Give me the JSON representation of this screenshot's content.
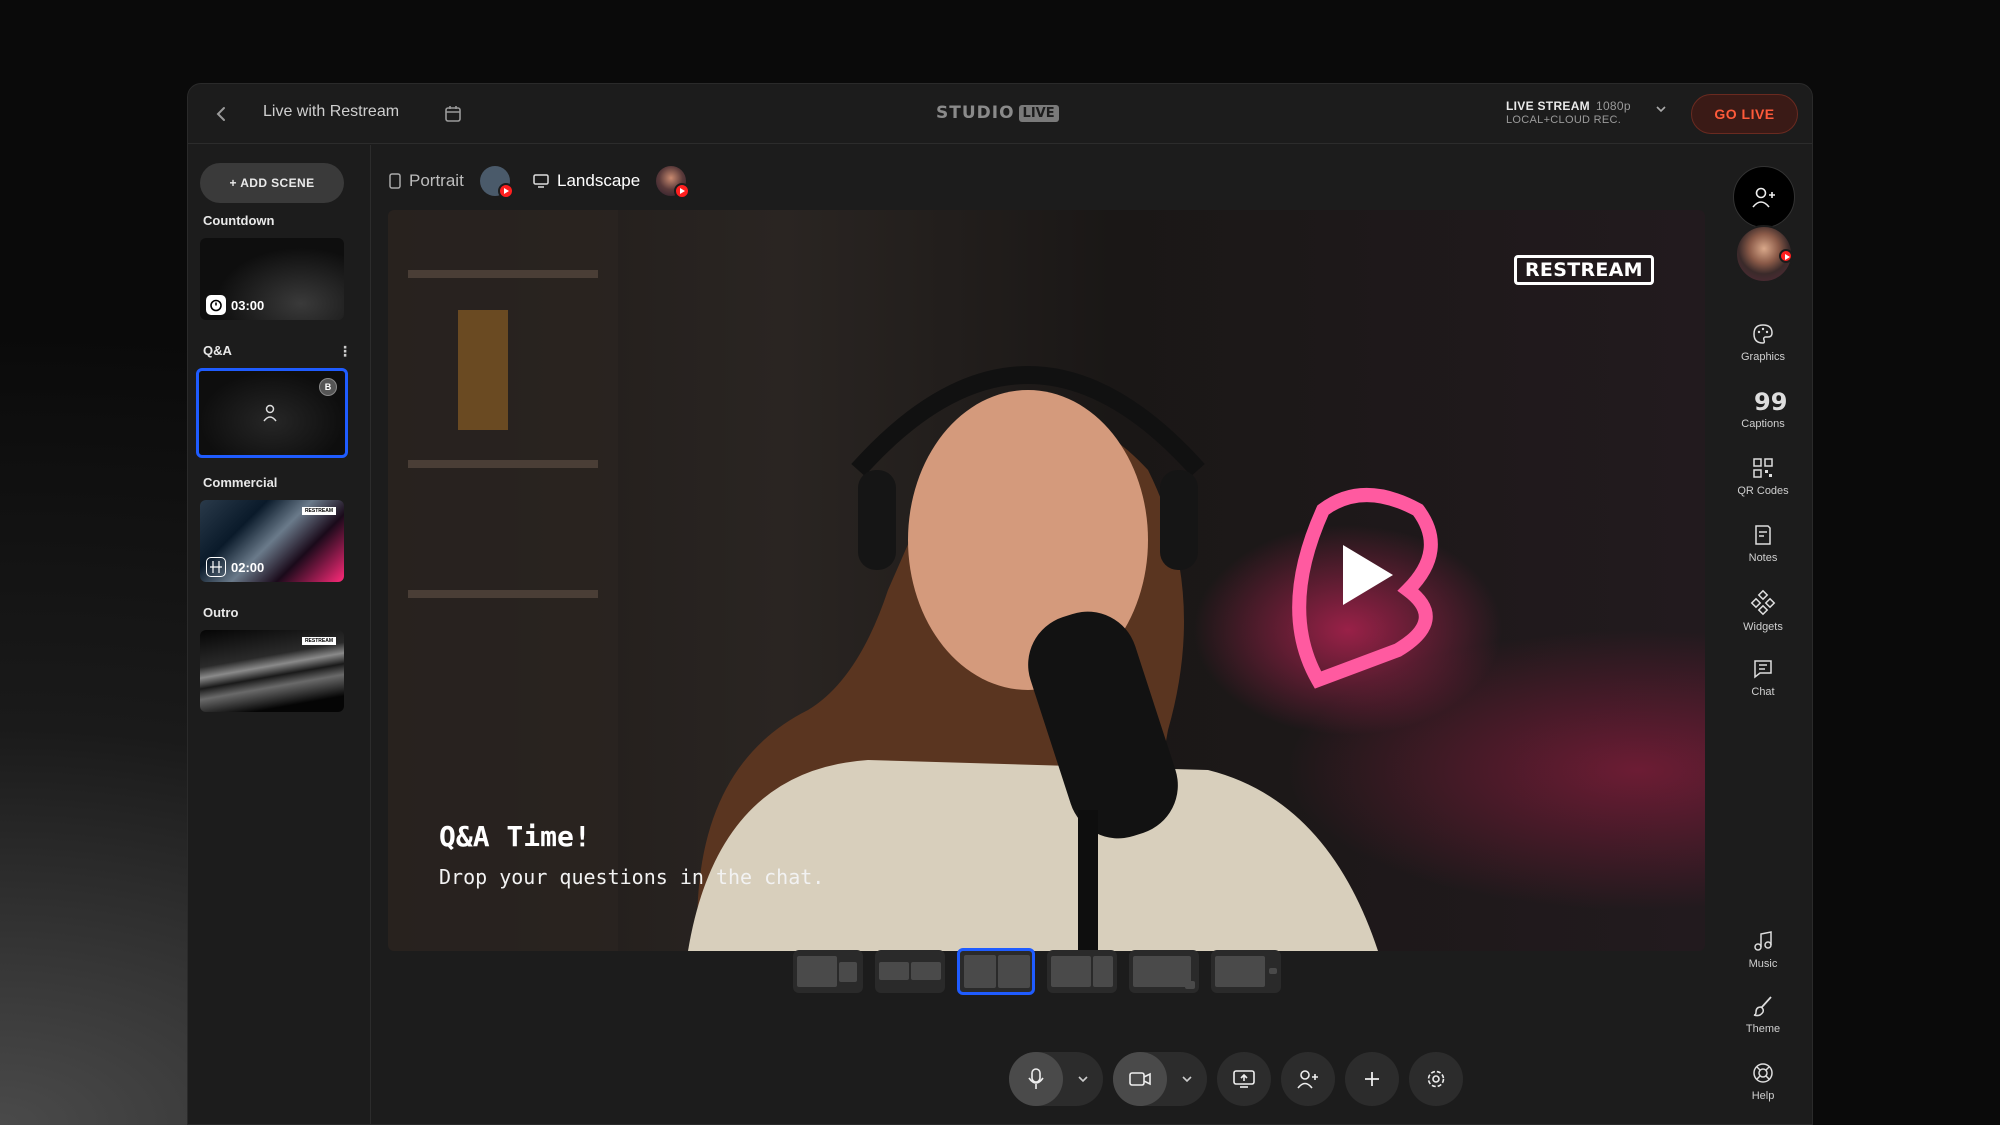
{
  "header": {
    "back_label": "‹",
    "title": "Live with Restream",
    "logo_studio": "STUDIO",
    "logo_live": "LIVE",
    "stream_label": "LIVE STREAM",
    "stream_quality": "1080p",
    "stream_rec": "LOCAL+CLOUD REC.",
    "go_live": "GO LIVE"
  },
  "sidebar": {
    "add_scene": "+ ADD SCENE",
    "scenes": [
      {
        "label": "Countdown",
        "time": "03:00"
      },
      {
        "label": "Q&A",
        "badge": "B"
      },
      {
        "label": "Commercial",
        "time": "02:00"
      },
      {
        "label": "Outro"
      }
    ]
  },
  "orientation": {
    "portrait": "Portrait",
    "landscape": "Landscape"
  },
  "canvas": {
    "logo": "RESTREAM",
    "overlay_title": "Q&A Time!",
    "overlay_subtitle": "Drop your questions in the chat."
  },
  "rail": {
    "tools": [
      "Graphics",
      "Captions",
      "QR Codes",
      "Notes",
      "Widgets",
      "Chat"
    ],
    "bottom_tools": [
      "Music",
      "Theme",
      "Help"
    ]
  },
  "colors": {
    "accent": "#1f5cff",
    "go_live": "#ff5a3a",
    "youtube": "#ff1f1f"
  },
  "selected_layout_index": 2
}
